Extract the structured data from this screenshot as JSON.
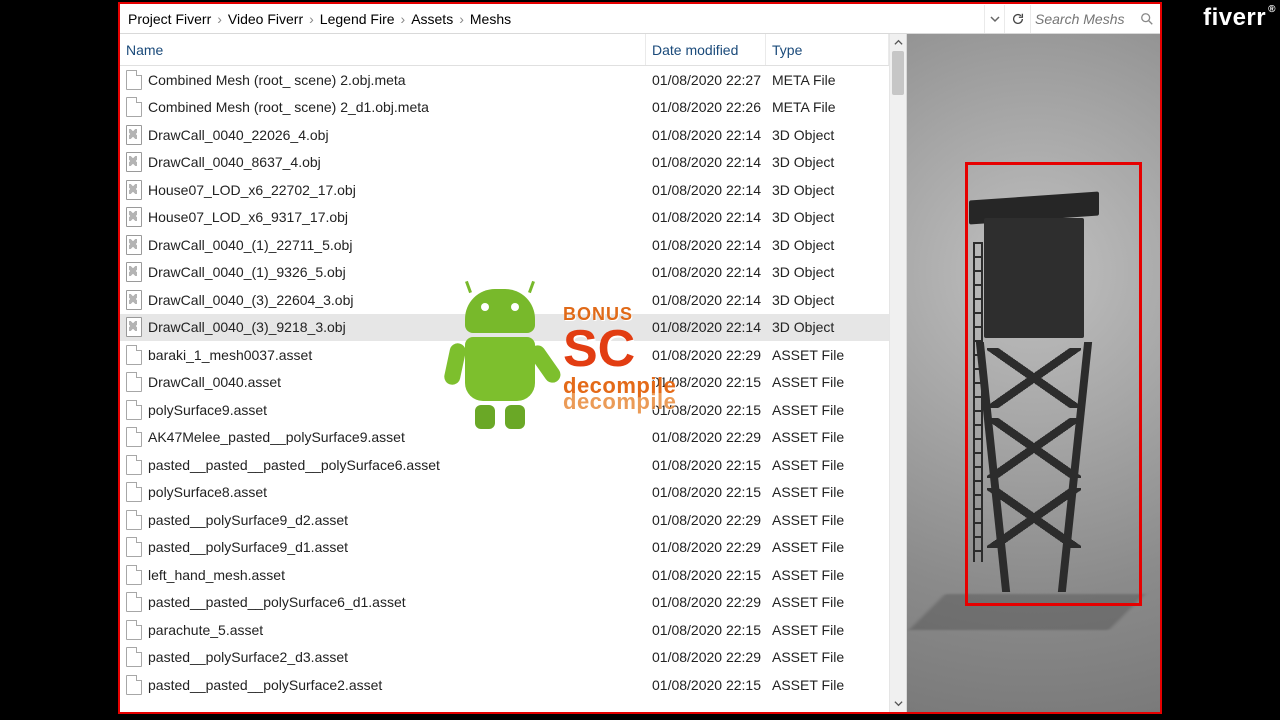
{
  "brand": "fiverr",
  "breadcrumbs": [
    "Project Fiverr",
    "Video Fiverr",
    "Legend Fire",
    "Assets",
    "Meshs"
  ],
  "search": {
    "placeholder": "Search Meshs"
  },
  "columns": {
    "name": "Name",
    "date": "Date modified",
    "type": "Type"
  },
  "watermark": {
    "bonus": "BONUS",
    "sc": "SC",
    "line1": "decompile",
    "line2": "decompile"
  },
  "selected_index": 9,
  "files": [
    {
      "icon": "page",
      "name": "Combined Mesh (root_ scene) 2.obj.meta",
      "date": "01/08/2020 22:27",
      "type": "META File"
    },
    {
      "icon": "page",
      "name": "Combined Mesh (root_ scene) 2_d1.obj.meta",
      "date": "01/08/2020 22:26",
      "type": "META File"
    },
    {
      "icon": "obj",
      "name": "DrawCall_0040_22026_4.obj",
      "date": "01/08/2020 22:14",
      "type": "3D Object"
    },
    {
      "icon": "obj",
      "name": "DrawCall_0040_8637_4.obj",
      "date": "01/08/2020 22:14",
      "type": "3D Object"
    },
    {
      "icon": "obj",
      "name": "House07_LOD_x6_22702_17.obj",
      "date": "01/08/2020 22:14",
      "type": "3D Object"
    },
    {
      "icon": "obj",
      "name": "House07_LOD_x6_9317_17.obj",
      "date": "01/08/2020 22:14",
      "type": "3D Object"
    },
    {
      "icon": "obj",
      "name": "DrawCall_0040_(1)_22711_5.obj",
      "date": "01/08/2020 22:14",
      "type": "3D Object"
    },
    {
      "icon": "obj",
      "name": "DrawCall_0040_(1)_9326_5.obj",
      "date": "01/08/2020 22:14",
      "type": "3D Object"
    },
    {
      "icon": "obj",
      "name": "DrawCall_0040_(3)_22604_3.obj",
      "date": "01/08/2020 22:14",
      "type": "3D Object"
    },
    {
      "icon": "obj",
      "name": "DrawCall_0040_(3)_9218_3.obj",
      "date": "01/08/2020 22:14",
      "type": "3D Object"
    },
    {
      "icon": "page",
      "name": "baraki_1_mesh0037.asset",
      "date": "01/08/2020 22:29",
      "type": "ASSET File"
    },
    {
      "icon": "page",
      "name": "DrawCall_0040.asset",
      "date": "01/08/2020 22:15",
      "type": "ASSET File"
    },
    {
      "icon": "page",
      "name": "polySurface9.asset",
      "date": "01/08/2020 22:15",
      "type": "ASSET File"
    },
    {
      "icon": "page",
      "name": "AK47Melee_pasted__polySurface9.asset",
      "date": "01/08/2020 22:29",
      "type": "ASSET File"
    },
    {
      "icon": "page",
      "name": "pasted__pasted__pasted__polySurface6.asset",
      "date": "01/08/2020 22:15",
      "type": "ASSET File"
    },
    {
      "icon": "page",
      "name": "polySurface8.asset",
      "date": "01/08/2020 22:15",
      "type": "ASSET File"
    },
    {
      "icon": "page",
      "name": "pasted__polySurface9_d2.asset",
      "date": "01/08/2020 22:29",
      "type": "ASSET File"
    },
    {
      "icon": "page",
      "name": "pasted__polySurface9_d1.asset",
      "date": "01/08/2020 22:29",
      "type": "ASSET File"
    },
    {
      "icon": "page",
      "name": "left_hand_mesh.asset",
      "date": "01/08/2020 22:15",
      "type": "ASSET File"
    },
    {
      "icon": "page",
      "name": "pasted__pasted__polySurface6_d1.asset",
      "date": "01/08/2020 22:29",
      "type": "ASSET File"
    },
    {
      "icon": "page",
      "name": "parachute_5.asset",
      "date": "01/08/2020 22:15",
      "type": "ASSET File"
    },
    {
      "icon": "page",
      "name": "pasted__polySurface2_d3.asset",
      "date": "01/08/2020 22:29",
      "type": "ASSET File"
    },
    {
      "icon": "page",
      "name": "pasted__pasted__polySurface2.asset",
      "date": "01/08/2020 22:15",
      "type": "ASSET File"
    }
  ]
}
